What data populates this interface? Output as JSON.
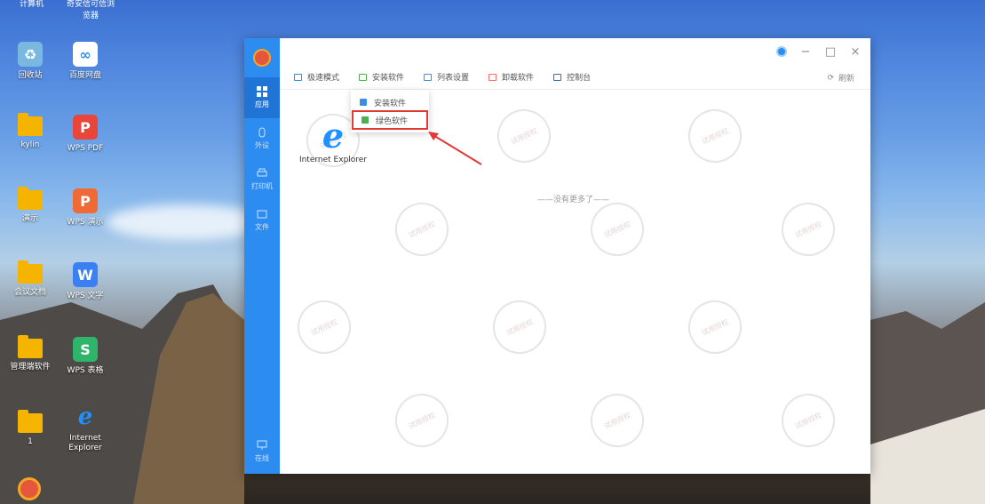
{
  "desktop": {
    "top_labels": [
      "计算机",
      "奇安信可信浏",
      "览器"
    ],
    "icons": [
      {
        "label": "回收站",
        "icon": "recycle-bin-icon"
      },
      {
        "label": "百度网盘",
        "icon": "baidu-netdisk-icon"
      },
      {
        "label": "kylin",
        "icon": "folder-icon"
      },
      {
        "label": "WPS PDF",
        "icon": "wps-pdf-icon"
      },
      {
        "label": "演示",
        "icon": "folder-icon"
      },
      {
        "label": "WPS 演示",
        "icon": "wps-presentation-icon"
      },
      {
        "label": "会议文档",
        "icon": "folder-icon"
      },
      {
        "label": "WPS 文字",
        "icon": "wps-writer-icon"
      },
      {
        "label": "管理端软件",
        "icon": "folder-icon"
      },
      {
        "label": "WPS 表格",
        "icon": "wps-spreadsheet-icon"
      },
      {
        "label": "1",
        "icon": "folder-icon"
      },
      {
        "label": "Internet Explorer",
        "icon": "ie-icon"
      }
    ]
  },
  "sidebar": {
    "items": [
      {
        "label": "应用",
        "active": true
      },
      {
        "label": "外设",
        "active": false
      },
      {
        "label": "打印机",
        "active": false
      },
      {
        "label": "文件",
        "active": false
      }
    ],
    "bottom_label": "在线"
  },
  "toolbar": {
    "items": [
      "极速模式",
      "安装软件",
      "列表设置",
      "卸载软件",
      "控制台"
    ],
    "refresh": "刷新"
  },
  "dropdown": {
    "items": [
      "安装软件",
      "绿色软件"
    ]
  },
  "content": {
    "app_label": "Internet Explorer",
    "empty_message": "——没有更多了——",
    "watermark": "试用授权"
  },
  "window_controls": {
    "minimize": "−",
    "maximize": "□",
    "close": "×"
  },
  "colors": {
    "accent": "#2d8cf0",
    "highlight": "#e53935"
  }
}
